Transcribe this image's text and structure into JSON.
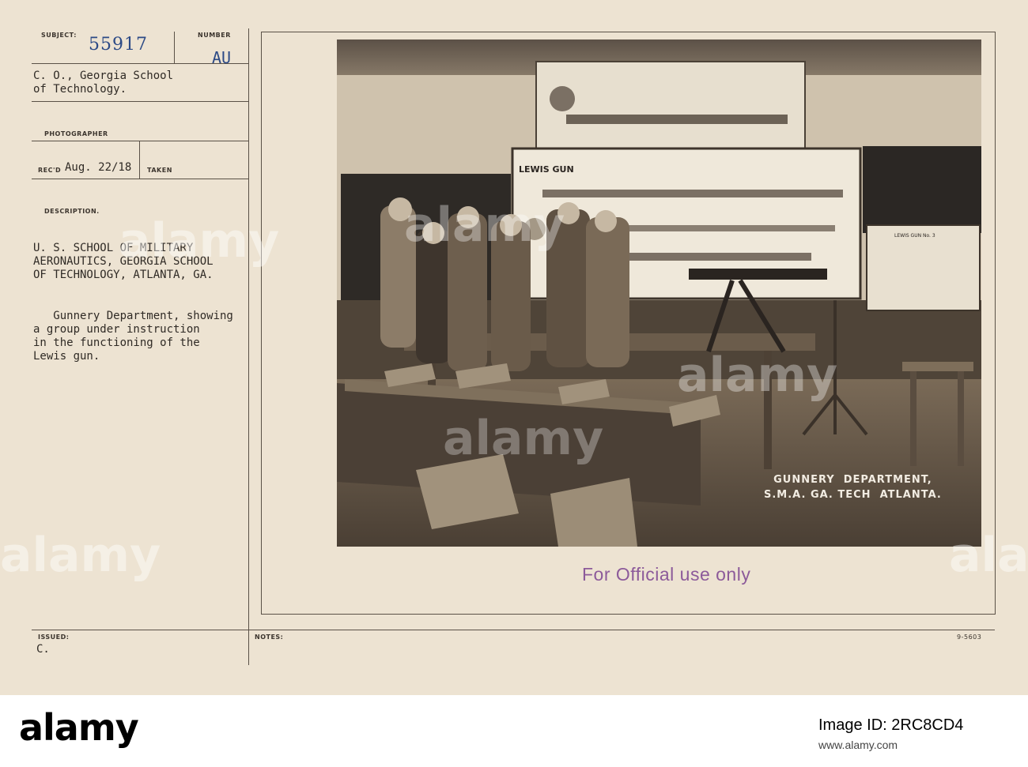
{
  "card": {
    "subject_label": "SUBJECT:",
    "subject_number": "55917",
    "number_label": "NUMBER",
    "number_value": "AU",
    "source": "C. O., Georgia School\nof Technology.",
    "photographer_label": "PHOTOGRAPHER",
    "received_label": "REC'D",
    "received_date": "Aug. 22/18",
    "taken_label": "TAKEN",
    "description_label": "DESCRIPTION.",
    "description_heading": "U. S. SCHOOL OF MILITARY\nAERONAUTICS, GEORGIA SCHOOL\nOF TECHNOLOGY, ATLANTA, GA.",
    "description_text": "   Gunnery Department, showing\na group under instruction\nin the functioning of the\nLewis gun.",
    "issued_label": "ISSUED:",
    "issued_value": "C.",
    "notes_label": "NOTES:",
    "form_number": "9-5603"
  },
  "photo": {
    "caption": "GUNNERY  DEPARTMENT,\nS.M.A. GA. TECH  ATLANTA.",
    "chart_title": "LEWIS GUN",
    "chart_title_2": "LEWIS GUN No. 3"
  },
  "stamp": "For Official use only",
  "footer": {
    "logo": "alamy",
    "image_id_label": "Image ID: 2RC8CD4",
    "site": "www.alamy.com"
  },
  "colors": {
    "card": "#ede3d2",
    "stamp_blue": "#2c4a86",
    "stamp_purple": "#8c5a9a"
  }
}
